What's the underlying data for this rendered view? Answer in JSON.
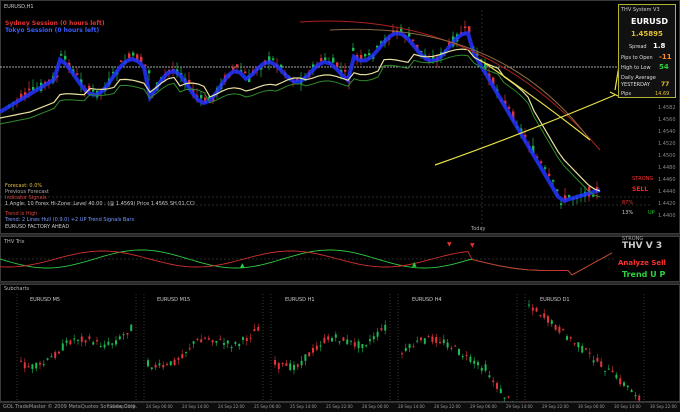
{
  "main_chart": {
    "symbol_header": "EURUSD,H1",
    "session_sydney": "Sydney Session (0 hours left)",
    "session_tokyo": "Tokyo Session (0 hours left)",
    "price_labels": [
      "1.4582",
      "1.4560",
      "1.4540",
      "1.4520",
      "1.4500",
      "1.4480",
      "1.4460",
      "1.4440",
      "1.4420",
      "1.4400"
    ],
    "signal_box": {
      "strong": "STRONG",
      "sell": "SELL",
      "percent": "87%",
      "up_percent": "13%",
      "up": "UP"
    },
    "annotation_today": "Today"
  },
  "scoreboard": {
    "title": "THV System V3",
    "symbol": "EURUSD",
    "price": "1.45895",
    "spread_label": "Spread",
    "spread_value": "1.8",
    "row1": "Pips to Open",
    "row1_val": "-11",
    "row2": "High to Low",
    "row2_val": "54",
    "row3": "Daily Average",
    "row4": "YESTERDAY",
    "row4_val": "77",
    "row5": "Pips",
    "row5_val": "14.69"
  },
  "info_lines": [
    "Forecast: 0.0%",
    "Previous Forecast",
    "Indicator Signals",
    "1 Angle: 10 Forex Hi-Zone: Level 40.00 : (@ 1.4569) Price 1.4565 SH.01.CCI",
    "Trend is High",
    "Trend: 2 Lines Hull (0.9.0) +2 UP Trend Signals Bars",
    "EURUSD FACTORY AHEAD"
  ],
  "indicator": {
    "header": "THV Trix",
    "thv_label": "THV V 3",
    "strong_label": "STRONG",
    "analyze": "Analyze Sell",
    "trend": "Trend U P"
  },
  "subcharts": {
    "header": "Subcharts",
    "titles": [
      "EURUSD M5",
      "EURUSD M15",
      "EURUSD H1",
      "EURUSD H4",
      "EURUSD D1"
    ]
  },
  "status": {
    "left": "GOL TradeMaster  © 2009 MetaQuotes Software Corp.",
    "time_labels": [
      "23 Sep 2009",
      "24 Sep 06:00",
      "24 Sep 14:00",
      "24 Sep 22:00",
      "25 Sep 06:00",
      "25 Sep 14:00",
      "25 Sep 22:00",
      "28 Sep 06:00",
      "28 Sep 14:00",
      "28 Sep 22:00",
      "29 Sep 06:00",
      "29 Sep 14:00",
      "29 Sep 22:00",
      "30 Sep 06:00",
      "30 Sep 14:00",
      "30 Sep 22:00"
    ]
  },
  "colors": {
    "bull": "#1db954",
    "bear": "#e0353a",
    "ma_blue": "#2233ff",
    "ma_yellow": "#e8e2a0",
    "ma_green": "#2e8b2e",
    "ma_red": "#b02020",
    "scoreboard_border": "#b4b232"
  }
}
